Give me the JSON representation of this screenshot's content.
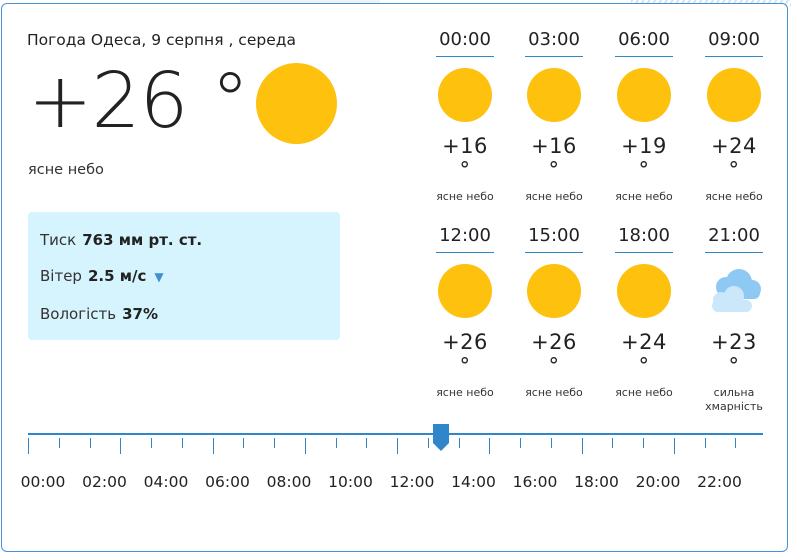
{
  "current": {
    "location_date": "Погода Одеса, 9 серпня , середа",
    "temperature": "+26 °",
    "icon": "sun-icon",
    "description": "ясне небо",
    "details": {
      "pressure_label": "Тиск",
      "pressure_value": "763 мм рт. ст.",
      "wind_label": "Вітер",
      "wind_value": "2.5 м/с",
      "humidity_label": "Вологість",
      "humidity_value": "37%"
    }
  },
  "hourly": [
    {
      "time": "00:00",
      "temp": "+16 °",
      "desc": "ясне небо",
      "icon": "sun-icon"
    },
    {
      "time": "03:00",
      "temp": "+16 °",
      "desc": "ясне небо",
      "icon": "sun-icon"
    },
    {
      "time": "06:00",
      "temp": "+19 °",
      "desc": "ясне небо",
      "icon": "sun-icon"
    },
    {
      "time": "09:00",
      "temp": "+24 °",
      "desc": "ясне небо",
      "icon": "sun-icon"
    },
    {
      "time": "12:00",
      "temp": "+26 °",
      "desc": "ясне небо",
      "icon": "sun-icon"
    },
    {
      "time": "15:00",
      "temp": "+26 °",
      "desc": "ясне небо",
      "icon": "sun-icon"
    },
    {
      "time": "18:00",
      "temp": "+24 °",
      "desc": "ясне небо",
      "icon": "sun-icon"
    },
    {
      "time": "21:00",
      "temp": "+23 °",
      "desc": "сильна хмарність",
      "icon": "cloud-icon"
    }
  ],
  "timeline": {
    "labels": [
      "00:00",
      "02:00",
      "04:00",
      "06:00",
      "08:00",
      "10:00",
      "12:00",
      "14:00",
      "16:00",
      "18:00",
      "20:00",
      "22:00"
    ],
    "current_position_hours": 13
  },
  "colors": {
    "accent": "#2f86c9",
    "sun": "#fdc10e",
    "panel": "#d6f4fd",
    "border": "#4a90d9"
  }
}
